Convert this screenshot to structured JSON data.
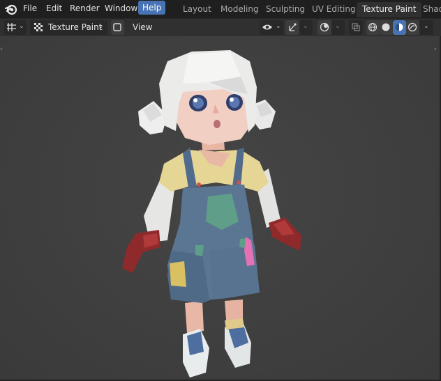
{
  "menubar": {
    "items": [
      "File",
      "Edit",
      "Render",
      "Window",
      "Help"
    ],
    "active_item": "Help"
  },
  "workspace_tabs": [
    "Layout",
    "Modeling",
    "Sculpting",
    "UV Editing",
    "Texture Paint",
    "Shadi"
  ],
  "active_workspace": "Texture Paint",
  "viewport_header": {
    "mode": "Texture Paint",
    "view_menu": "View",
    "viewport_shading_active": "material-preview"
  },
  "icons": {
    "logo": "blender-logo-icon",
    "editor_type": "editor-type-icon",
    "mode": "texture-paint-mode-icon",
    "visibility": "eye-icon",
    "gizmo": "gizmo-icon",
    "overlays": "overlays-icon",
    "xray": "xray-icon",
    "shading": [
      "wireframe-icon",
      "solid-icon",
      "material-preview-icon",
      "rendered-icon"
    ]
  },
  "colors": {
    "accent": "#4772b3",
    "viewport_bg": "#404040",
    "header_bg": "#303030",
    "topbar_bg": "#1f1f1f"
  }
}
